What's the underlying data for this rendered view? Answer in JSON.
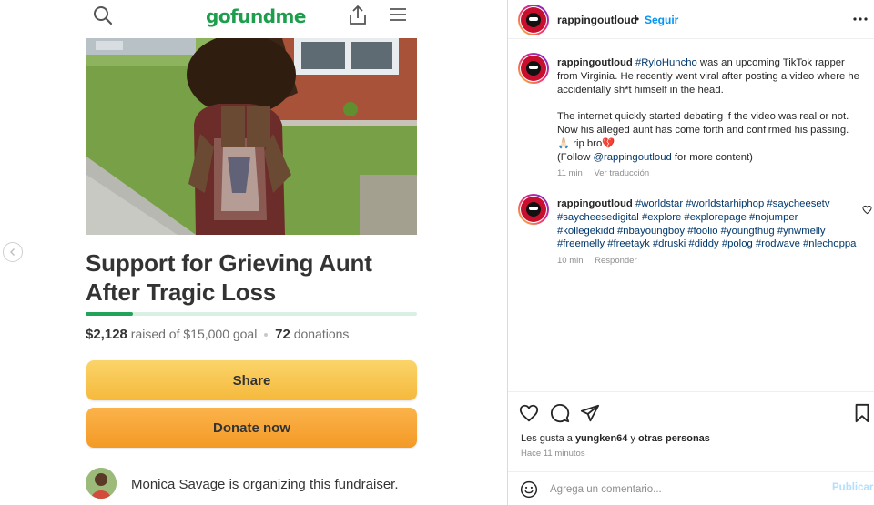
{
  "gofundme": {
    "logo_text": "gofundme",
    "title_line1": "Support for Grieving Aunt",
    "title_line2": "After Tragic Loss",
    "raised": "$2,128",
    "raised_label": "raised of $15,000 goal",
    "donations_count": "72",
    "donations_label": "donations",
    "progress_fraction": 0.142,
    "share_label": "Share",
    "donate_label": "Donate now",
    "organizer_text": "Monica Savage is organizing this fundraiser.",
    "brand_color": "#1d9e4c"
  },
  "post": {
    "username": "rappingoutloud",
    "separator": "•",
    "follow_label": "Seguir",
    "caption": {
      "username": "rappingoutloud",
      "tag": "#RyloHuncho",
      "text1": " was an upcoming TikTok rapper from Virginia. He recently went viral after posting a video where he accidentally sh*t himself in the head.",
      "text2": "The internet quickly started debating if the video was real or not. Now his alleged aunt has come forth and confirmed his passing.",
      "text3": "🙏🏻 rip bro💔",
      "text4_pre": "(Follow ",
      "text4_mention": "@rappingoutloud",
      "text4_post": " for more content)",
      "time": "11 min",
      "translate": "Ver traducción"
    },
    "comment": {
      "username": "rappingoutloud",
      "hashtags": "#worldstar #worldstarhiphop #saycheesetv #saycheesedigital #explore #explorepage #nojumper #kollegekidd #nbayoungboy #foolio #youngthug #ynwmelly #freemelly #freetayk #druski #diddy #polog #rodwave #nlechoppa",
      "time": "10 min",
      "reply": "Responder"
    },
    "likes_prefix": "Les gusta a ",
    "likes_user": "yungken64",
    "likes_mid": " y ",
    "likes_others": "otras personas",
    "time_ago": "Hace 11 minutos",
    "comment_placeholder": "Agrega un comentario...",
    "publish_label": "Publicar",
    "accent_color": "#0095f6"
  }
}
